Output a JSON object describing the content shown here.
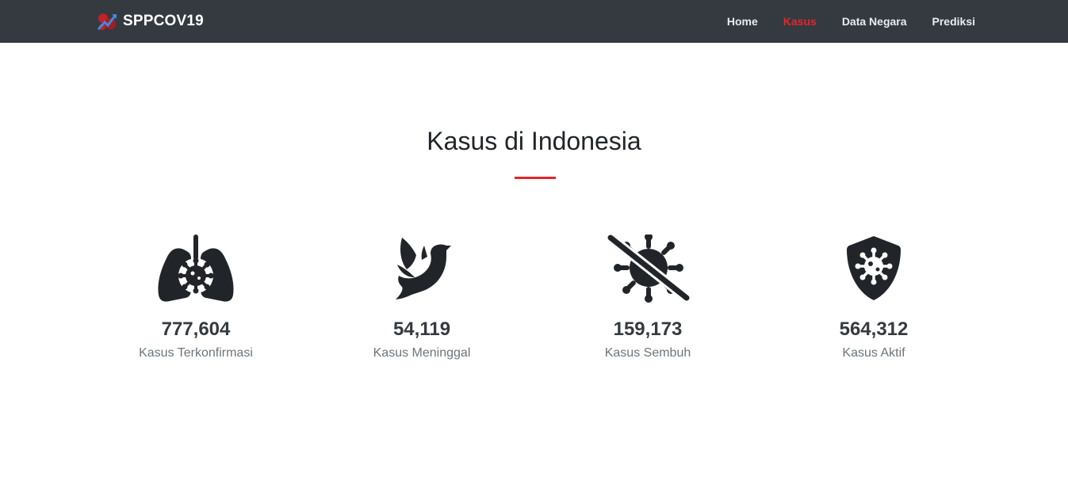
{
  "navbar": {
    "brand": "SPPCOV19",
    "links": [
      {
        "label": "Home",
        "active": false
      },
      {
        "label": "Kasus",
        "active": true
      },
      {
        "label": "Data Negara",
        "active": false
      },
      {
        "label": "Prediksi",
        "active": false
      }
    ]
  },
  "section": {
    "title": "Kasus di Indonesia"
  },
  "stats": [
    {
      "icon": "lungs-virus-icon",
      "value": "777,604",
      "label": "Kasus Terkonfirmasi"
    },
    {
      "icon": "dove-icon",
      "value": "54,119",
      "label": "Kasus Meninggal"
    },
    {
      "icon": "virus-slash-icon",
      "value": "159,173",
      "label": "Kasus Sembuh"
    },
    {
      "icon": "shield-virus-icon",
      "value": "564,312",
      "label": "Kasus Aktif"
    }
  ],
  "colors": {
    "navbar_bg": "#343a40",
    "accent": "#e3262b",
    "icon": "#212529",
    "label": "#6c757d"
  }
}
